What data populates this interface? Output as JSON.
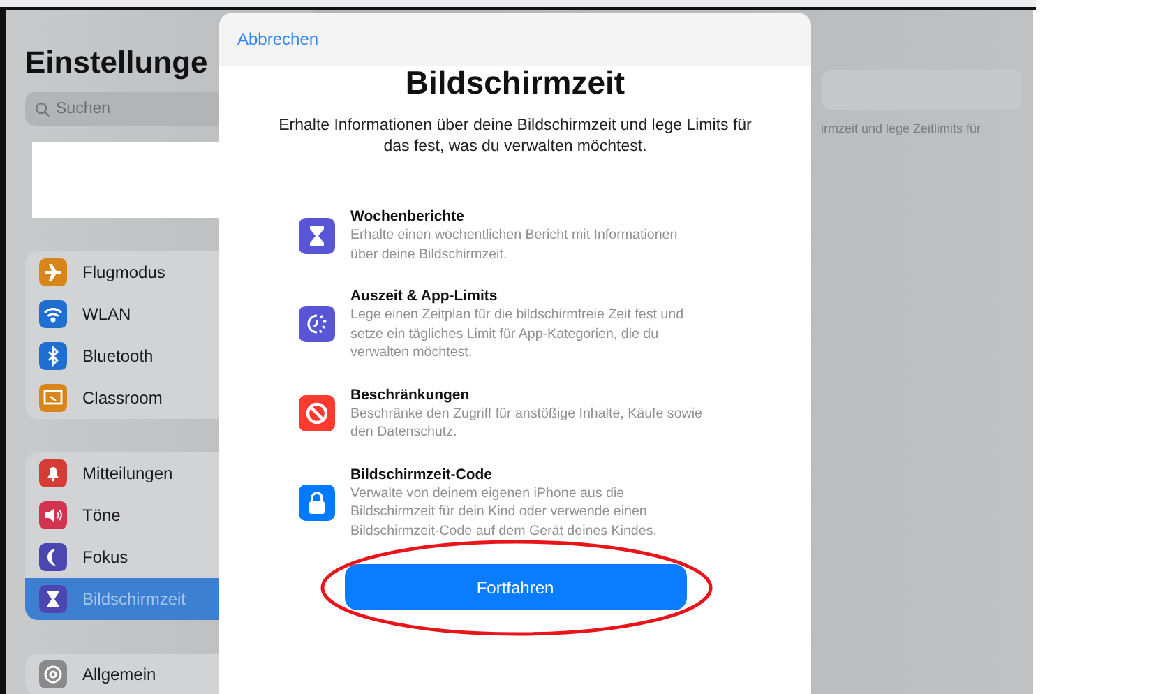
{
  "sidebar": {
    "title": "Einstellunge",
    "search": {
      "placeholder": "Suchen"
    },
    "groups": [
      {
        "items": [
          {
            "label": "Flugmodus",
            "color": "#d8861a",
            "selected": false
          },
          {
            "label": "WLAN",
            "color": "#1f6fd0",
            "selected": false
          },
          {
            "label": "Bluetooth",
            "color": "#1f6fd0",
            "selected": false
          },
          {
            "label": "Classroom",
            "color": "#d8861a",
            "selected": false
          }
        ]
      },
      {
        "items": [
          {
            "label": "Mitteilungen",
            "color": "#d43c35",
            "selected": false
          },
          {
            "label": "Töne",
            "color": "#d4334f",
            "selected": false
          },
          {
            "label": "Fokus",
            "color": "#4c46b0",
            "selected": false
          },
          {
            "label": "Bildschirmzeit",
            "color": "#4c46b0",
            "selected": true
          }
        ]
      },
      {
        "items": [
          {
            "label": "Allgemein",
            "color": "#8a8a8c",
            "selected": false
          }
        ]
      }
    ]
  },
  "background_text": "irmzeit und lege Zeitlimits für",
  "modal": {
    "cancel": "Abbrechen",
    "title": "Bildschirmzeit",
    "subtitle": "Erhalte Informationen über deine Bildschirmzeit und lege Limits für das fest, was du verwalten möchtest.",
    "features": [
      {
        "title": "Wochenberichte",
        "text": "Erhalte einen wöchentlichen Bericht mit Informationen über deine Bildschirmzeit.",
        "color": "#5856d6"
      },
      {
        "title": "Auszeit & App-Limits",
        "text": "Lege einen Zeitplan für die bildschirmfreie Zeit fest und setze ein tägliches Limit für App-Kategorien, die du verwalten möchtest.",
        "color": "#5856d6"
      },
      {
        "title": "Beschränkungen",
        "text": "Beschränke den Zugriff für anstößige Inhalte, Käufe sowie den Datenschutz.",
        "color": "#ff3b30"
      },
      {
        "title": "Bildschirmzeit-Code",
        "text": "Verwalte von deinem eigenen iPhone aus die Bildschirmzeit für dein Kind oder verwende einen Bildschirmzeit-Code auf dem Gerät deines Kindes.",
        "color": "#007aff"
      }
    ],
    "button": "Fortfahren"
  }
}
